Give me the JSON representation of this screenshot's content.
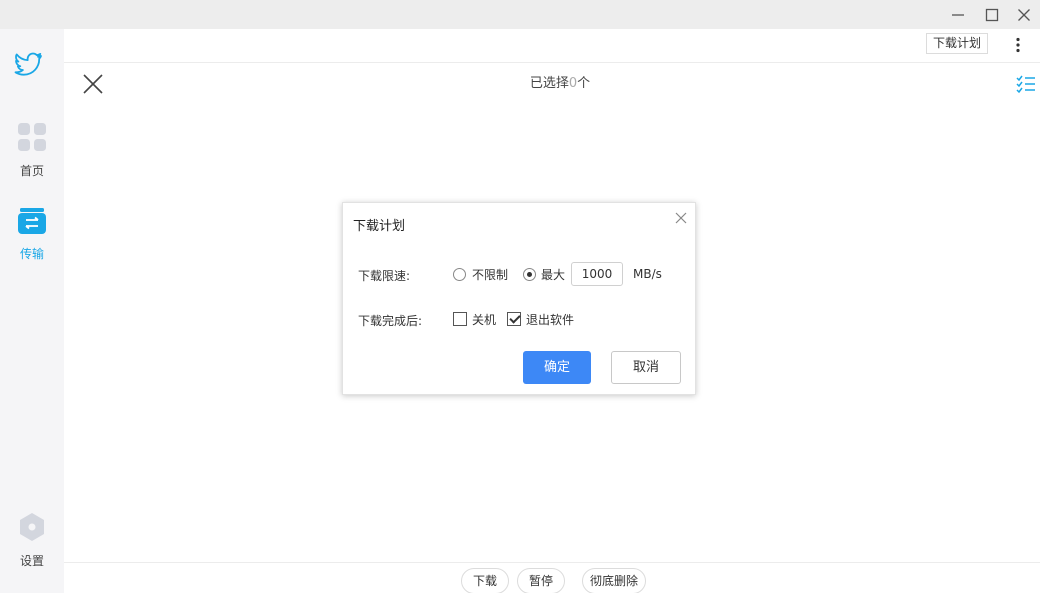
{
  "window": {
    "minimize_icon": "minimize-icon",
    "maximize_icon": "maximize-icon",
    "close_icon": "close-icon"
  },
  "sidebar": {
    "logo_icon": "bird-logo-icon",
    "items": [
      {
        "label": "首页",
        "icon": "grid-icon",
        "active": false
      },
      {
        "label": "传输",
        "icon": "transfer-icon",
        "active": true
      },
      {
        "label": "设置",
        "icon": "gear-icon",
        "active": false
      }
    ]
  },
  "topbar": {
    "plan_label": "下载计划",
    "more_icon": "more-vertical-icon"
  },
  "selection": {
    "prefix": "已选择",
    "count": "0",
    "suffix": "个"
  },
  "dialog": {
    "title": "下载计划",
    "speed_label": "下载限速:",
    "option_unlimited": "不限制",
    "option_max": "最大",
    "speed_value": "1000",
    "speed_unit": "MB/s",
    "selected_option": "max",
    "after_label": "下载完成后:",
    "shutdown_label": "关机",
    "shutdown_checked": false,
    "exit_label": "退出软件",
    "exit_checked": true,
    "ok_label": "确定",
    "cancel_label": "取消"
  },
  "bottom": {
    "download_label": "下载",
    "pause_label": "暂停",
    "delete_label": "彻底删除"
  },
  "colors": {
    "accent": "#1aa7e6",
    "primary_button": "#3d88f6"
  }
}
